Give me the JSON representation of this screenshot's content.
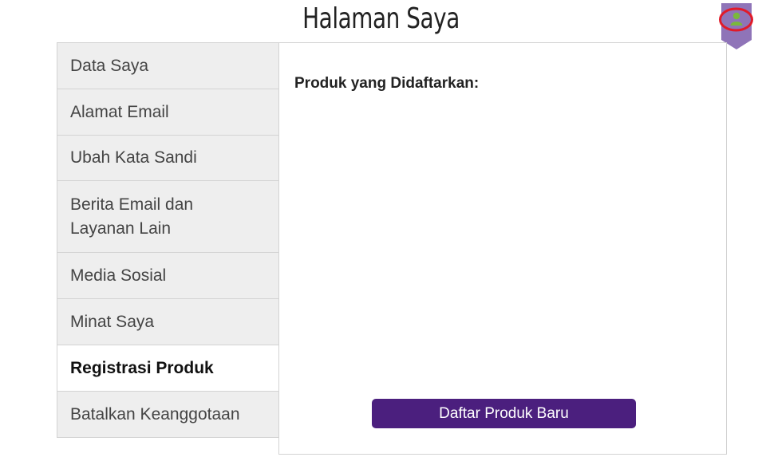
{
  "page": {
    "title": "Halaman Saya"
  },
  "sidebar": {
    "items": [
      {
        "label": "Data Saya",
        "active": false
      },
      {
        "label": "Alamat Email",
        "active": false
      },
      {
        "label": "Ubah Kata Sandi",
        "active": false
      },
      {
        "label": "Berita Email dan Layanan Lain",
        "active": false
      },
      {
        "label": "Media Sosial",
        "active": false
      },
      {
        "label": "Minat Saya",
        "active": false
      },
      {
        "label": "Registrasi Produk",
        "active": true
      },
      {
        "label": "Batalkan Keanggotaan",
        "active": false
      }
    ]
  },
  "main": {
    "heading": "Produk yang Didaftarkan:",
    "button_label": "Daftar Produk Baru"
  },
  "colors": {
    "accent": "#4b1f7e",
    "user_tab": "#8f74b8",
    "user_icon": "#7ab83c",
    "highlight_ring": "#e01b2a"
  },
  "icons": {
    "user": "user-icon"
  }
}
